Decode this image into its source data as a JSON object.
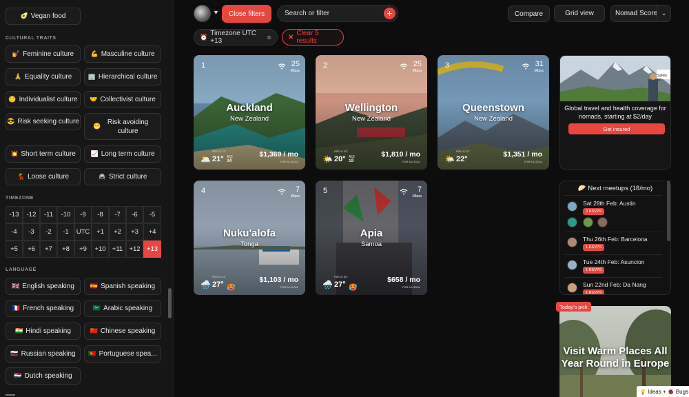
{
  "sidebar": {
    "vegan_food": {
      "emoji": "🥑",
      "label": "Vegan food"
    },
    "cultural_traits": {
      "title": "CULTURAL TRAITS",
      "items": [
        {
          "emoji": "💅",
          "label": "Feminine culture"
        },
        {
          "emoji": "💪",
          "label": "Masculine culture"
        },
        {
          "emoji": "🙏",
          "label": "Equality culture"
        },
        {
          "emoji": "🏢",
          "label": "Hierarchical culture"
        },
        {
          "emoji": "😌",
          "label": "Individualist culture"
        },
        {
          "emoji": "🤝",
          "label": "Collectivist culture"
        },
        {
          "emoji": "😎",
          "label": "Risk seeking culture"
        },
        {
          "emoji": "😬",
          "label": "Risk avoiding culture"
        },
        {
          "emoji": "💥",
          "label": "Short term culture"
        },
        {
          "emoji": "📈",
          "label": "Long term culture"
        },
        {
          "emoji": "💃",
          "label": "Loose culture"
        },
        {
          "emoji": "🚔",
          "label": "Strict culture"
        }
      ]
    },
    "timezone": {
      "title": "TIMEZONE",
      "values": [
        "-13",
        "-12",
        "-11",
        "-10",
        "-9",
        "-8",
        "-7",
        "-6",
        "-5",
        "-4",
        "-3",
        "-2",
        "-1",
        "UTC",
        "+1",
        "+2",
        "+3",
        "+4",
        "+5",
        "+6",
        "+7",
        "+8",
        "+9",
        "+10",
        "+11",
        "+12",
        "+13"
      ],
      "selected": "+13"
    },
    "language": {
      "title": "LANGUAGE",
      "items": [
        {
          "emoji": "🇬🇧",
          "label": "English speaking"
        },
        {
          "emoji": "🇪🇸",
          "label": "Spanish speaking"
        },
        {
          "emoji": "🇫🇷",
          "label": "French speaking"
        },
        {
          "emoji": "🇸🇦",
          "label": "Arabic speaking"
        },
        {
          "emoji": "🇮🇳",
          "label": "Hindi speaking"
        },
        {
          "emoji": "🇨🇳",
          "label": "Chinese speaking"
        },
        {
          "emoji": "🇷🇺",
          "label": "Russian speaking"
        },
        {
          "emoji": "🇵🇹",
          "label": "Portuguese spea..."
        },
        {
          "emoji": "🇳🇱",
          "label": "Dutch speaking"
        }
      ]
    }
  },
  "toolbar": {
    "close_filters": "Close filters",
    "search_placeholder": "Search or filter",
    "compare": "Compare",
    "grid_view": "Grid view",
    "sort": "Nomad Score"
  },
  "filters": {
    "timezone_tag": "Timezone UTC +13",
    "clear_label": "Clear 5 results"
  },
  "cities": [
    {
      "rank": "1",
      "name": "Auckland",
      "country": "New Zealand",
      "speed": "25",
      "feels": "FEELS 21°",
      "temp": "21°",
      "aqi": "34",
      "weather": "🌥️",
      "price": "$1,369 / mo"
    },
    {
      "rank": "2",
      "name": "Wellington",
      "country": "New Zealand",
      "speed": "25",
      "feels": "FEELS 20°",
      "temp": "20°",
      "aqi": "19",
      "weather": "🌤️",
      "price": "$1,810 / mo"
    },
    {
      "rank": "3",
      "name": "Queenstown",
      "country": "New Zealand",
      "speed": "31",
      "feels": "FEELS 22°",
      "temp": "22°",
      "aqi": "",
      "weather": "🌤️",
      "price": "$1,351 / mo"
    },
    {
      "rank": "4",
      "name": "Nuku'alofa",
      "country": "Tonga",
      "speed": "7",
      "feels": "FEELS 31°",
      "temp": "27°",
      "aqi": "",
      "weather": "🌧️",
      "extra": "🥵",
      "price": "$1,103 / mo"
    },
    {
      "rank": "5",
      "name": "Apia",
      "country": "Samoa",
      "speed": "7",
      "feels": "FEELS 30°",
      "temp": "27°",
      "aqi": "",
      "weather": "🌧️",
      "extra": "🥵",
      "price": "$658 / mo"
    }
  ],
  "card_labels": {
    "mbps": "Mbps",
    "aqi": "AQI",
    "for_local": "FOR A LOCAL"
  },
  "ad": {
    "text": "Global travel and health coverage for nomads, starting at $2/day",
    "button": "Get insured",
    "brand": "Safety Wi"
  },
  "meetups": {
    "title": "🥟 Next meetups (18/mo)",
    "items": [
      {
        "date": "Sat 28th Feb: Austin",
        "rsvps": "3 RSVPS"
      },
      {
        "date": "Thu 26th Feb: Barcelona",
        "rsvps": "1 RSVPS"
      },
      {
        "date": "Tue 24th Feb: Asuncion",
        "rsvps": "1 RSVPS"
      },
      {
        "date": "Sun 22nd Feb: Da Nang",
        "rsvps": "1 RSVPS"
      }
    ]
  },
  "todays_pick": {
    "badge": "Today's pick",
    "text": "Visit Warm Places All Year Round in Europe"
  },
  "feedback": {
    "ideas": "💡 Ideas +",
    "bugs": "🐞 Bugs"
  },
  "colors": {
    "accent": "#e8473f",
    "background": "#0d0d0d",
    "panel": "#161616"
  }
}
